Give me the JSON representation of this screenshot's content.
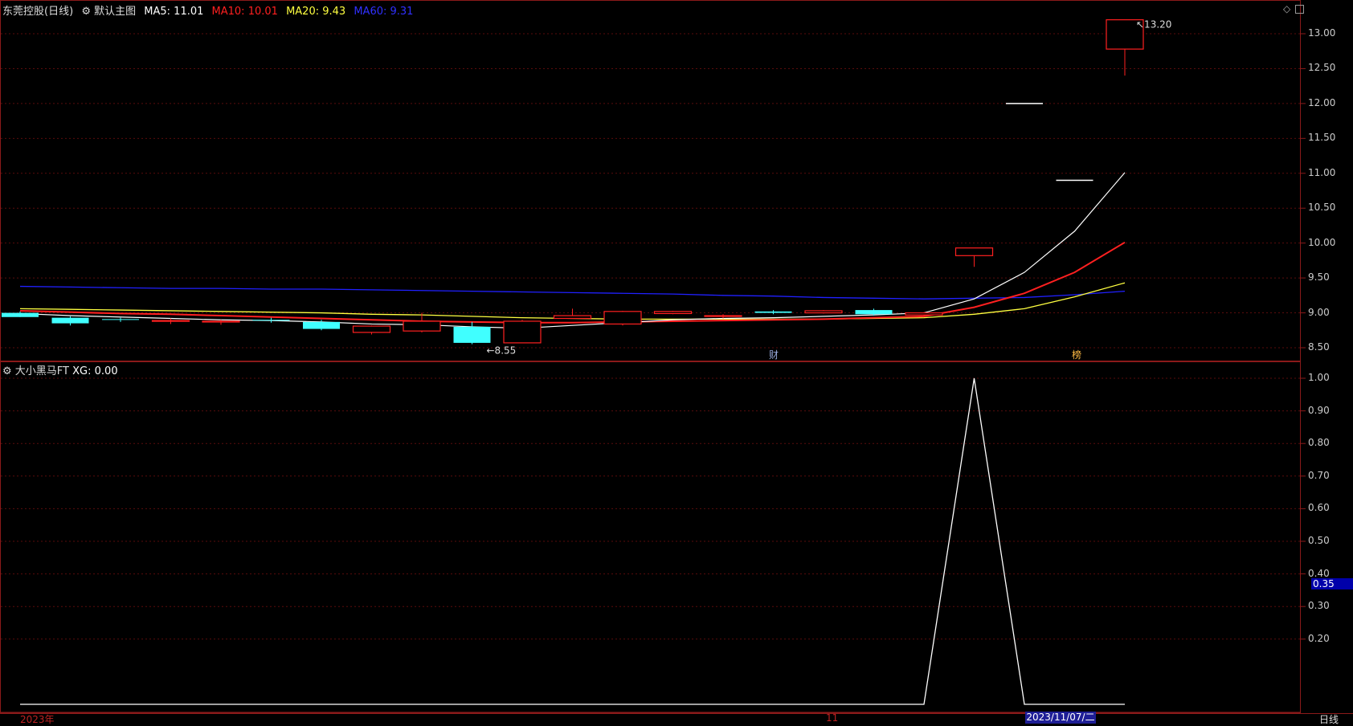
{
  "header": {
    "stock_name": "东莞控股",
    "period": "(日线)",
    "template": "默认主图",
    "ma5": {
      "label": "MA5:",
      "value": "11.01",
      "color": "#ffffff"
    },
    "ma10": {
      "label": "MA10:",
      "value": "10.01",
      "color": "#ff2020"
    },
    "ma20": {
      "label": "MA20:",
      "value": "9.43",
      "color": "#ffff40"
    },
    "ma60": {
      "label": "MA60:",
      "value": "9.31",
      "color": "#2020ff"
    }
  },
  "sub_header": {
    "indicator": "大小黑马FT",
    "xg_label": "XG:",
    "xg_value": "0.00"
  },
  "main_axis": [
    "13.00",
    "12.50",
    "12.00",
    "11.50",
    "11.00",
    "10.50",
    "10.00",
    "9.50",
    "9.00",
    "8.50"
  ],
  "sub_axis": [
    "1.00",
    "0.90",
    "0.80",
    "0.70",
    "0.60",
    "0.50",
    "0.40",
    "0.30",
    "0.20"
  ],
  "annotations": {
    "high": "13.20",
    "low": "8.55",
    "cai_marker": "财",
    "bang_marker": "榜"
  },
  "sub_value_box": "0.35",
  "bottom": {
    "year": "2023年",
    "month": "11",
    "cursor_date": "2023/11/07/二",
    "period_tab": "日线"
  },
  "colors": {
    "up": "#ff2020",
    "down": "#40ffff",
    "border": "#8b1a1a",
    "ma5": "#ffffff",
    "ma10": "#ff2020",
    "ma20": "#ffff40",
    "ma60": "#2020ff"
  },
  "chart_data": {
    "type": "candlestick",
    "price_range": [
      8.35,
      13.25
    ],
    "candles": [
      {
        "o": 9.0,
        "h": 9.02,
        "l": 8.94,
        "c": 8.94
      },
      {
        "o": 8.93,
        "h": 8.95,
        "l": 8.82,
        "c": 8.85
      },
      {
        "o": 8.91,
        "h": 8.93,
        "l": 8.87,
        "c": 8.9
      },
      {
        "o": 8.88,
        "h": 8.92,
        "l": 8.84,
        "c": 8.89
      },
      {
        "o": 8.87,
        "h": 8.9,
        "l": 8.83,
        "c": 8.88
      },
      {
        "o": 8.9,
        "h": 8.93,
        "l": 8.86,
        "c": 8.89
      },
      {
        "o": 8.87,
        "h": 8.9,
        "l": 8.75,
        "c": 8.77
      },
      {
        "o": 8.72,
        "h": 8.82,
        "l": 8.69,
        "c": 8.81
      },
      {
        "o": 8.74,
        "h": 9.0,
        "l": 8.72,
        "c": 8.88
      },
      {
        "o": 8.8,
        "h": 8.87,
        "l": 8.55,
        "c": 8.57
      },
      {
        "o": 8.57,
        "h": 8.9,
        "l": 8.57,
        "c": 8.88
      },
      {
        "o": 8.92,
        "h": 9.06,
        "l": 8.92,
        "c": 8.96
      },
      {
        "o": 8.84,
        "h": 9.03,
        "l": 8.82,
        "c": 9.02
      },
      {
        "o": 8.99,
        "h": 9.03,
        "l": 8.98,
        "c": 9.02
      },
      {
        "o": 8.95,
        "h": 8.98,
        "l": 8.92,
        "c": 8.96
      },
      {
        "o": 9.02,
        "h": 9.04,
        "l": 8.98,
        "c": 9.0
      },
      {
        "o": 9.0,
        "h": 9.04,
        "l": 8.99,
        "c": 9.03
      },
      {
        "o": 9.04,
        "h": 9.06,
        "l": 8.96,
        "c": 8.98
      },
      {
        "o": 8.97,
        "h": 9.01,
        "l": 8.95,
        "c": 9.0
      },
      {
        "o": 9.82,
        "h": 9.93,
        "l": 9.66,
        "c": 9.93
      },
      {
        "o": 12.0,
        "h": 12.0,
        "l": 12.0,
        "c": 12.0
      },
      {
        "o": 10.9,
        "h": 10.9,
        "l": 10.9,
        "c": 10.9
      },
      {
        "o": 12.78,
        "h": 13.2,
        "l": 12.4,
        "c": 13.2
      }
    ],
    "ma5": [
      8.99,
      8.96,
      8.94,
      8.92,
      8.9,
      8.89,
      8.87,
      8.84,
      8.83,
      8.8,
      8.78,
      8.82,
      8.86,
      8.9,
      8.92,
      8.93,
      8.95,
      8.97,
      9.0,
      9.2,
      9.58,
      10.17,
      11.01
    ],
    "ma10": [
      9.03,
      9.01,
      8.99,
      8.98,
      8.96,
      8.94,
      8.92,
      8.9,
      8.88,
      8.87,
      8.86,
      8.86,
      8.87,
      8.88,
      8.89,
      8.9,
      8.91,
      8.93,
      8.95,
      9.08,
      9.28,
      9.58,
      10.01
    ],
    "ma20": [
      9.06,
      9.05,
      9.04,
      9.03,
      9.02,
      9.01,
      9.0,
      8.98,
      8.97,
      8.95,
      8.93,
      8.92,
      8.91,
      8.91,
      8.91,
      8.91,
      8.91,
      8.92,
      8.93,
      8.98,
      9.06,
      9.23,
      9.43
    ],
    "ma60": [
      9.38,
      9.37,
      9.36,
      9.35,
      9.35,
      9.34,
      9.34,
      9.33,
      9.32,
      9.31,
      9.3,
      9.29,
      9.28,
      9.27,
      9.25,
      9.24,
      9.22,
      9.21,
      9.2,
      9.21,
      9.22,
      9.26,
      9.31
    ],
    "xg_series": [
      0,
      0,
      0,
      0,
      0,
      0,
      0,
      0,
      0,
      0,
      0,
      0,
      0,
      0,
      0,
      0,
      0,
      0,
      0,
      1,
      0,
      0,
      0
    ],
    "xg_range": [
      0,
      1.0
    ]
  }
}
